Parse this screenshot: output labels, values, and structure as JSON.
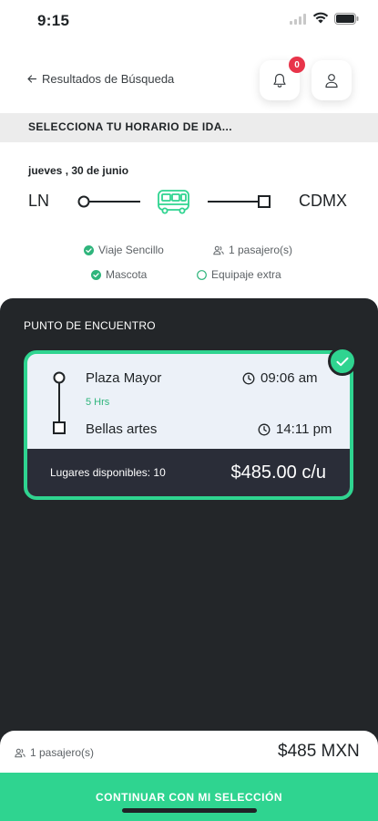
{
  "status_bar": {
    "time": "9:15"
  },
  "header": {
    "back_label": "Resultados de Búsqueda",
    "notification_count": "0"
  },
  "section_title": "SELECCIONA TU HORARIO DE IDA...",
  "trip": {
    "date": "jueves , 30 de junio",
    "origin": "LN",
    "destination": "CDMX"
  },
  "options": {
    "trip_type": "Viaje Sencillo",
    "passengers": "1 pasajero(s)",
    "pet": "Mascota",
    "extra_luggage": "Equipaje extra"
  },
  "panel": {
    "title": "PUNTO DE ENCUENTRO"
  },
  "card": {
    "departure_stop": "Plaza Mayor",
    "duration": "5 Hrs",
    "arrival_stop": "Bellas artes",
    "departure_time": "09:06 am",
    "arrival_time": "14:11 pm",
    "seats_available": "Lugares disponibles: 10",
    "price": "$485.00 c/u",
    "selected": true
  },
  "summary": {
    "passengers": "1 pasajero(s)",
    "total": "$485 MXN",
    "cta_label": "CONTINUAR CON MI SELECCIÓN"
  },
  "colors": {
    "accent": "#2fd490",
    "panel": "#232629",
    "card": "#ecf1f8",
    "card_footer": "#2a2d38",
    "badge": "#e8344a"
  }
}
